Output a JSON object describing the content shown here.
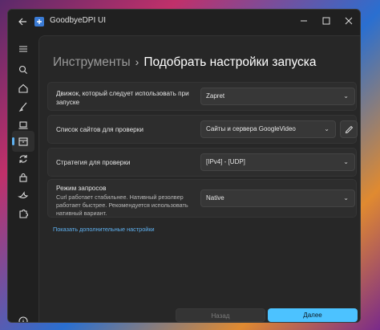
{
  "window": {
    "title": "GoodbyeDPI UI"
  },
  "breadcrumb": {
    "parent": "Инструменты",
    "separator": "›",
    "current": "Подобрать настройки запуска"
  },
  "settings": [
    {
      "label": "Движок, который следует использовать при запуске",
      "description": "",
      "value": "Zapret"
    },
    {
      "label": "Список сайтов для проверки",
      "description": "",
      "value": "Сайты и сервера GoogleVideo"
    },
    {
      "label": "Стратегия для проверки",
      "description": "",
      "value": "[IPv4] - [UDP]"
    },
    {
      "label": "Режим запросов",
      "description": "Curl работает стабильнее. Нативный резолвер работает быстрее. Рекомендуется использовать нативный вариант.",
      "value": "Native"
    }
  ],
  "links": {
    "advanced": "Показать дополнительные настройки"
  },
  "buttons": {
    "back": "Назад",
    "next": "Далее"
  },
  "icons": {
    "back": "arrow-left-icon",
    "minimize": "minimize-icon",
    "maximize": "maximize-icon",
    "close": "close-icon",
    "menu": "hamburger-icon",
    "search": "search-icon",
    "home": "home-icon",
    "brush": "brush-icon",
    "laptop": "laptop-icon",
    "tools": "toolbox-icon",
    "sync": "sync-icon",
    "lock": "lock-icon",
    "bird": "bird-icon",
    "puzzle": "puzzle-icon",
    "info": "info-icon",
    "edit": "pencil-icon"
  },
  "colors": {
    "accent": "#4cc2ff",
    "link": "#5fb2f2"
  }
}
